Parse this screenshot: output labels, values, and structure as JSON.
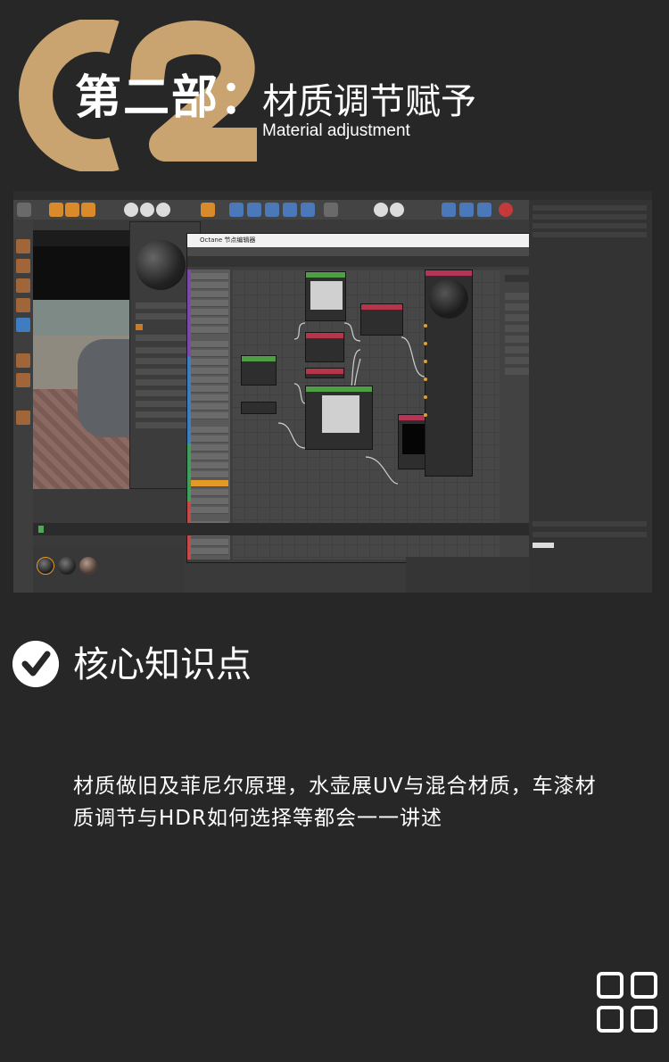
{
  "header": {
    "part_number": "02",
    "section_title": "第二部：",
    "subtitle": "材质调节赋予",
    "subtitle_en": "Material adjustment",
    "accent_color": "#c9a470"
  },
  "screenshot": {
    "description_free": true,
    "window_title": "Octane 节点编辑器"
  },
  "knowledge": {
    "title": "核心知识点",
    "description": "材质做旧及菲尼尔原理，水壶展UV与混合材质，车漆材质调节与HDR如何选择等都会一一讲述"
  },
  "icons": {
    "check": "check-icon",
    "grid": "grid-menu-icon"
  }
}
